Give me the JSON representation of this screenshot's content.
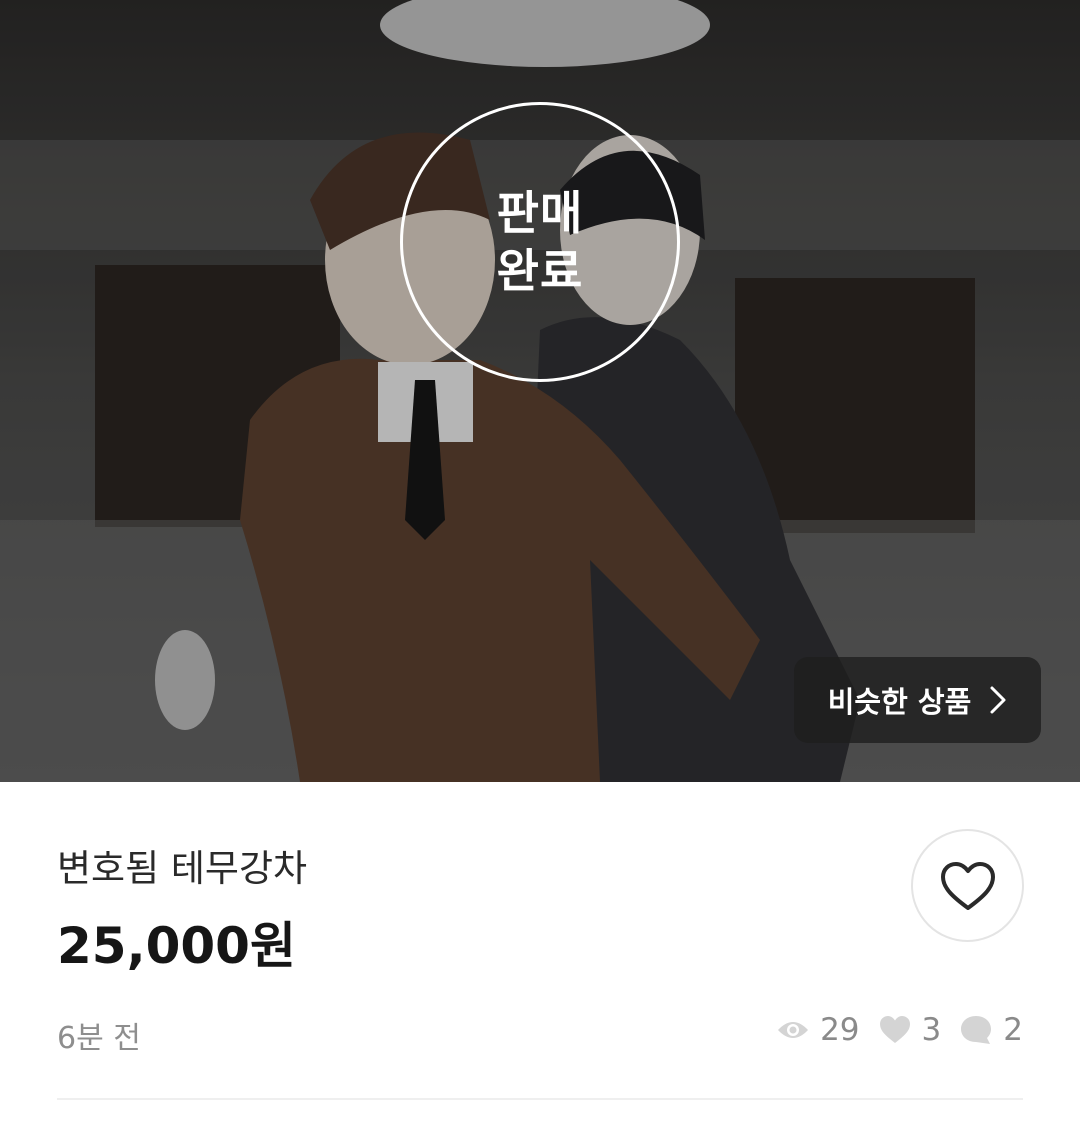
{
  "hero": {
    "sold_badge_line1": "판매",
    "sold_badge_line2": "완료",
    "similar_button_label": "비슷한 상품"
  },
  "product": {
    "title": "변호됨 테무강차",
    "price": "25,000원",
    "posted_time": "6분 전"
  },
  "stats": {
    "views": "29",
    "likes": "3",
    "comments": "2"
  },
  "icons": {
    "like_button": "heart-outline-icon",
    "views": "eye-icon",
    "likes": "heart-filled-icon",
    "comments": "chat-bubble-icon",
    "similar": "chevron-right-icon"
  },
  "colors": {
    "text_primary": "#161616",
    "text_secondary": "#8e8e8e",
    "badge": "#ffffff",
    "overlay_button": "#1e1e1e"
  }
}
